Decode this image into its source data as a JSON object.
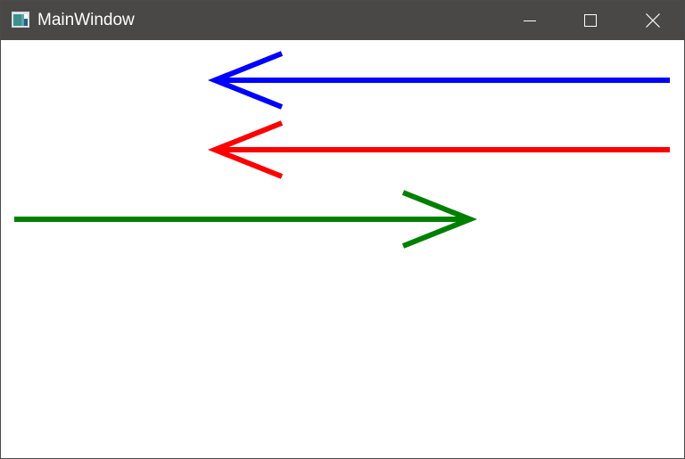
{
  "window": {
    "title": "MainWindow",
    "titlebar_color": "#4a4846"
  },
  "controls": {
    "minimize_icon": "minimize-icon",
    "maximize_icon": "maximize-icon",
    "close_icon": "close-icon"
  },
  "arrows": [
    {
      "name": "blue-arrow",
      "direction": "left",
      "color": "#0000ff"
    },
    {
      "name": "red-arrow",
      "direction": "left",
      "color": "#ff0000"
    },
    {
      "name": "green-arrow",
      "direction": "right",
      "color": "#008000"
    }
  ]
}
